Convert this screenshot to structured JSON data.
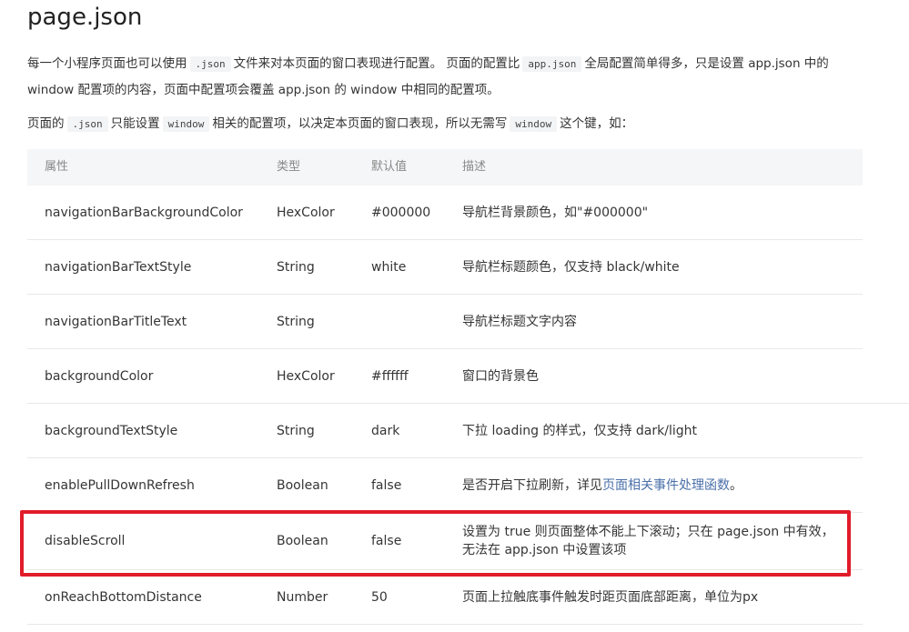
{
  "heading": "page.json",
  "intro": {
    "s1": "每一个小程序页面也可以使用",
    "code1": ".json",
    "s2": "文件来对本页面的窗口表现进行配置。 页面的配置比",
    "code2": "app.json",
    "s3": "全局配置简单得多，只是设置 app.json 中的 window 配置项的内容，页面中配置项会覆盖 app.json 的 window 中相同的配置项。"
  },
  "note": {
    "s1": "页面的",
    "code1": ".json",
    "s2": "只能设置",
    "code2": "window",
    "s3": "相关的配置项，以决定本页面的窗口表现，所以无需写",
    "code3": "window",
    "s4": "这个键，如："
  },
  "table": {
    "headers": {
      "attr": "属性",
      "type": "类型",
      "default": "默认值",
      "desc": "描述"
    },
    "rows": [
      {
        "attr": "navigationBarBackgroundColor",
        "type": "HexColor",
        "default": "#000000",
        "desc": "导航栏背景颜色，如\"#000000\""
      },
      {
        "attr": "navigationBarTextStyle",
        "type": "String",
        "default": "white",
        "desc": "导航栏标题颜色，仅支持 black/white"
      },
      {
        "attr": "navigationBarTitleText",
        "type": "String",
        "default": "",
        "desc": "导航栏标题文字内容"
      },
      {
        "attr": "backgroundColor",
        "type": "HexColor",
        "default": "#ffffff",
        "desc": "窗口的背景色"
      },
      {
        "attr": "backgroundTextStyle",
        "type": "String",
        "default": "dark",
        "desc": "下拉 loading 的样式，仅支持 dark/light"
      },
      {
        "attr": "enablePullDownRefresh",
        "type": "Boolean",
        "default": "false",
        "desc": "是否开启下拉刷新，详见",
        "desc_link": "页面相关事件处理函数",
        "desc_after": "。"
      },
      {
        "attr": "disableScroll",
        "type": "Boolean",
        "default": "false",
        "desc": "设置为 true 则页面整体不能上下滚动；只在 page.json 中有效，无法在 app.json 中设置该项"
      },
      {
        "attr": "onReachBottomDistance",
        "type": "Number",
        "default": "50",
        "desc": "页面上拉触底事件触发时距页面底部距离，单位为px"
      }
    ]
  },
  "highlight_color": "#e11c2a"
}
